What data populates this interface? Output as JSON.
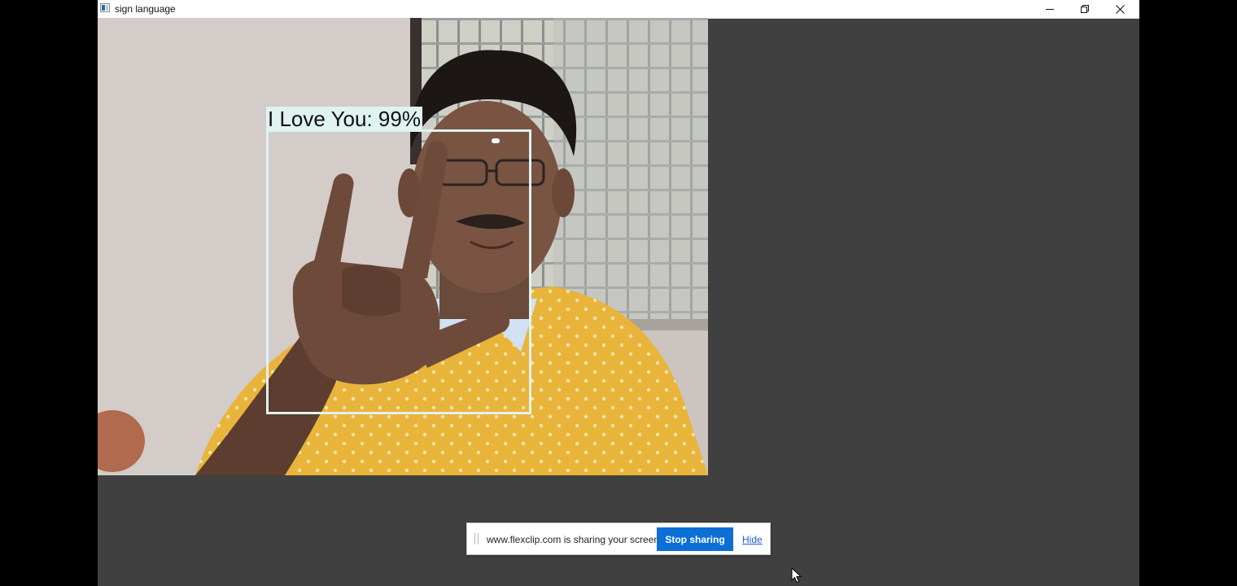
{
  "window": {
    "title": "sign language",
    "controls": [
      "minimize-icon",
      "restore-icon",
      "close-icon"
    ]
  },
  "detection": {
    "label": "I Love You: 99%",
    "box_color": "#dff3f1"
  },
  "share_bar": {
    "message": "www.flexclip.com is sharing your screen.",
    "stop_label": "Stop sharing",
    "hide_label": "Hide",
    "button_color": "#0b6fd6"
  },
  "colors": {
    "window_bg": "#404040",
    "outer_bg": "#000000",
    "shirt": "#e8b53a"
  }
}
